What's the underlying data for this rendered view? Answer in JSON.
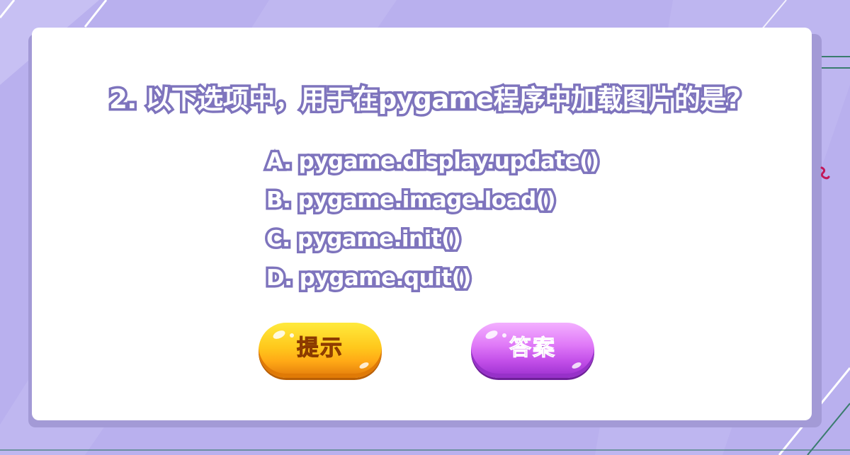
{
  "question": {
    "text": "2. 以下选项中，用于在pygame程序中加载图片的是?"
  },
  "options": [
    {
      "label": "A. pygame.display.update()"
    },
    {
      "label": "B. pygame.image.load()"
    },
    {
      "label": "C. pygame.init()"
    },
    {
      "label": "D. pygame.quit()"
    }
  ],
  "buttons": {
    "hint_label": "提示",
    "answer_label": "答案"
  },
  "colors": {
    "background": "#b9b0ee",
    "card": "#ffffff",
    "text_outline": "#7e74bd",
    "hint_button": "#ffc81c",
    "answer_button": "#e07af8"
  }
}
